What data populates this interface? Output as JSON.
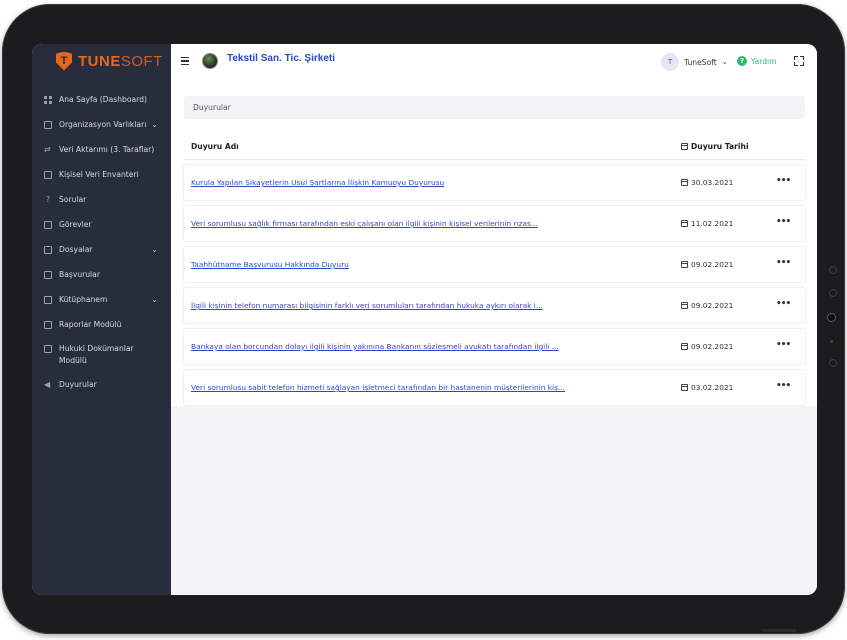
{
  "brand": {
    "name_part1": "TUNE",
    "name_part2": "SOFT",
    "accent": "#e8671b"
  },
  "sidebar": {
    "items": [
      {
        "label": "Ana Sayfa (Dashboard)",
        "icon": "dashboard-icon",
        "chevron": false
      },
      {
        "label": "Organizasyon Varlıkları",
        "icon": "organization-icon",
        "chevron": true
      },
      {
        "label": "Veri Aktarımı (3. Taraflar)",
        "icon": "transfer-icon",
        "chevron": false
      },
      {
        "label": "Kişisel Veri Envanteri",
        "icon": "inventory-icon",
        "chevron": false
      },
      {
        "label": "Sorular",
        "icon": "question-icon",
        "chevron": false
      },
      {
        "label": "Görevler",
        "icon": "tasks-icon",
        "chevron": false
      },
      {
        "label": "Dosyalar",
        "icon": "folder-icon",
        "chevron": true
      },
      {
        "label": "Başvurular",
        "icon": "applications-icon",
        "chevron": false
      },
      {
        "label": "Kütüphanem",
        "icon": "library-icon",
        "chevron": true
      },
      {
        "label": "Raporlar Modülü",
        "icon": "reports-icon",
        "chevron": false
      },
      {
        "label": "Hukuki Dokümanlar Modülü",
        "icon": "legal-docs-icon",
        "chevron": false
      },
      {
        "label": "Duyurular",
        "icon": "megaphone-icon",
        "chevron": false
      }
    ]
  },
  "header": {
    "company_name": "Tekstil San. Tic. Şirketi",
    "user_initial": "T",
    "user_name": "TuneSoft",
    "user_chevron": "⌄",
    "help_label": "Yardım",
    "help_symbol": "?"
  },
  "breadcrumb": "Duyurular",
  "table": {
    "col_name": "Duyuru Adı",
    "col_date": "Duyuru Tarihi",
    "rows": [
      {
        "title": "Kurula Yapılan Şikayetlerin Usul Şartlarına İlişkin Kamuoyu Duyurusu",
        "date": "30.03.2021"
      },
      {
        "title": "Veri sorumlusu sağlık firması tarafından eski çalışanı olan ilgili kişinin kişisel verilerinin rızas...",
        "date": "11.02.2021"
      },
      {
        "title": "Taahhütname Başvurusu Hakkında Duyuru",
        "date": "09.02.2021"
      },
      {
        "title": "İlgili kişinin telefon numarası bilgisinin farklı veri sorumluları tarafından hukuka aykırı olarak i...",
        "date": "09.02.2021"
      },
      {
        "title": "Bankaya olan borcundan dolayı ilgili kişinin yakınına Bankanın sözleşmeli avukatı tarafından ilgili ...",
        "date": "09.02.2021"
      },
      {
        "title": "Veri sorumlusu sabit telefon hizmeti sağlayan işletmeci tarafından bir hastanenin müşterilerinin kiş...",
        "date": "03.02.2021"
      }
    ]
  },
  "row_menu_glyph": "•••",
  "colors": {
    "sidebar": "#282d3e",
    "link": "#2b48c9",
    "help": "#2dbb6b"
  }
}
